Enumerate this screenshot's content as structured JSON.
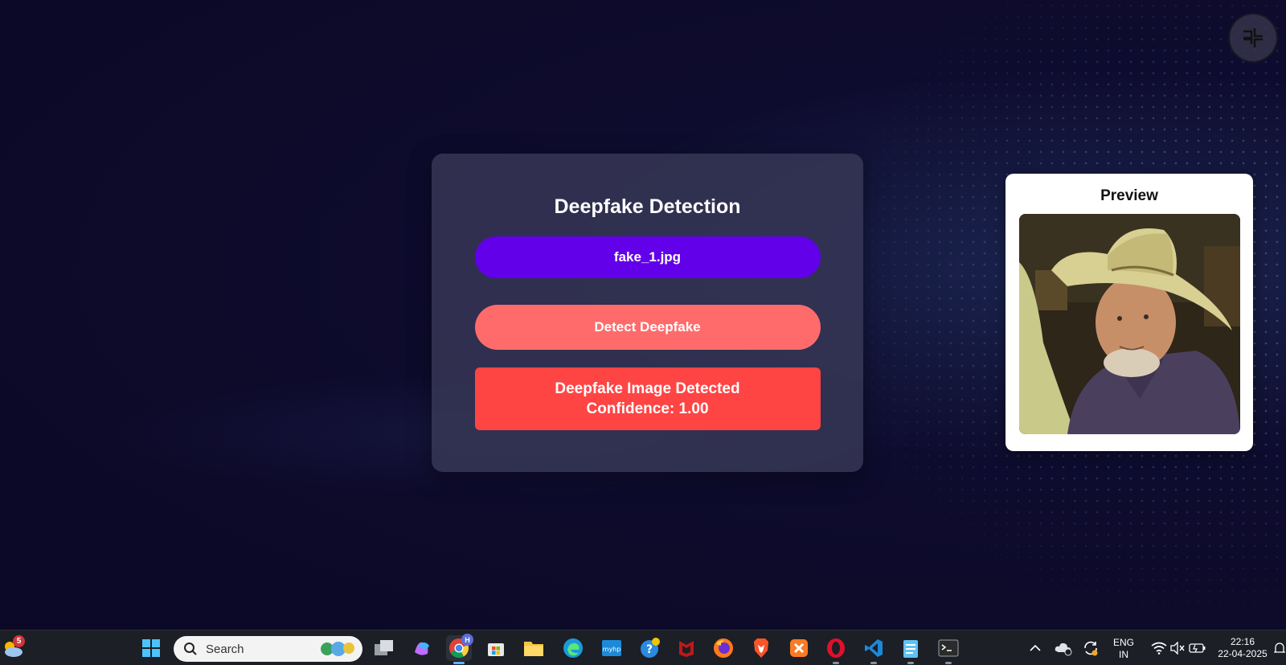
{
  "card": {
    "title": "Deepfake Detection",
    "file_label": "fake_1.jpg",
    "detect_label": "Detect Deepfake",
    "result_line1": "Deepfake Image Detected",
    "result_line2": "Confidence: 1.00"
  },
  "preview": {
    "title": "Preview"
  },
  "taskbar": {
    "weather_badge": "5",
    "search_placeholder": "Search",
    "chrome_profile": "H",
    "lang": "ENG",
    "region": "IN",
    "time": "22:16",
    "date": "22-04-2025",
    "icons": [
      "start-icon",
      "search-icon",
      "task-view-icon",
      "copilot-icon",
      "chrome-icon",
      "store-icon",
      "file-explorer-icon",
      "edge-icon",
      "myhp-icon",
      "help-icon",
      "mcafee-icon",
      "firefox-icon",
      "brave-icon",
      "xampp-icon",
      "opera-icon",
      "vscode-icon",
      "notepad-icon",
      "terminal-icon"
    ]
  },
  "colors": {
    "file_button": "#6200ea",
    "detect_button": "#ff6b6b",
    "result_box": "#ff4444",
    "card_bg": "#3a3a58"
  }
}
